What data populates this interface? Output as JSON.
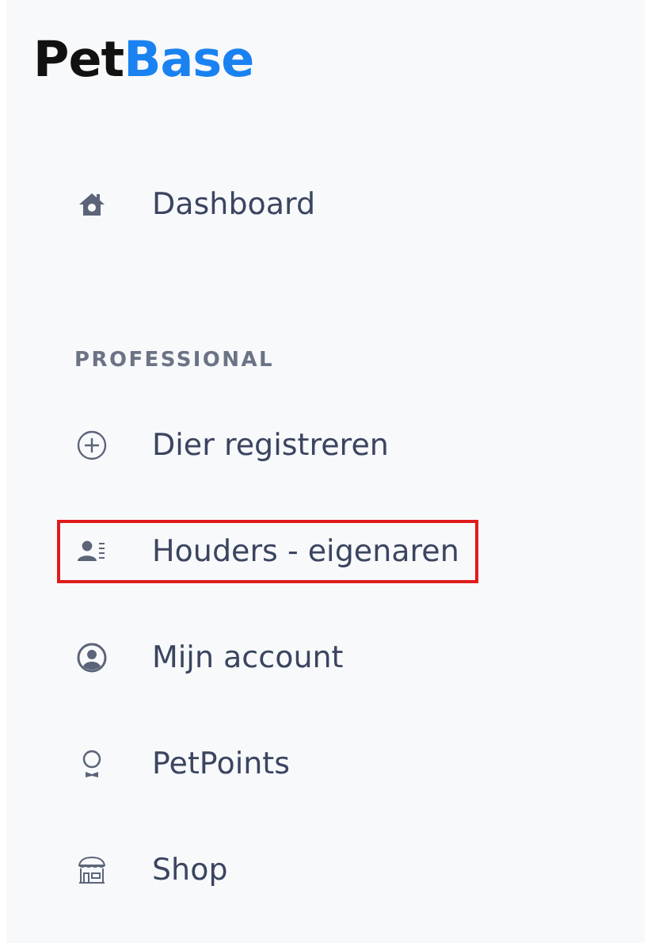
{
  "logo": {
    "part_1": "Pet",
    "part_2": "Base"
  },
  "main_items": [
    {
      "label": "Dashboard",
      "highlighted": false
    }
  ],
  "sections": [
    {
      "title": "PROFESSIONAL",
      "items": [
        {
          "label": "Dier registreren",
          "highlighted": false
        },
        {
          "label": "Houders - eigenaren",
          "highlighted": true
        },
        {
          "label": "Mijn account",
          "highlighted": false
        },
        {
          "label": "PetPoints",
          "highlighted": false
        },
        {
          "label": "Shop",
          "highlighted": false
        }
      ]
    }
  ]
}
